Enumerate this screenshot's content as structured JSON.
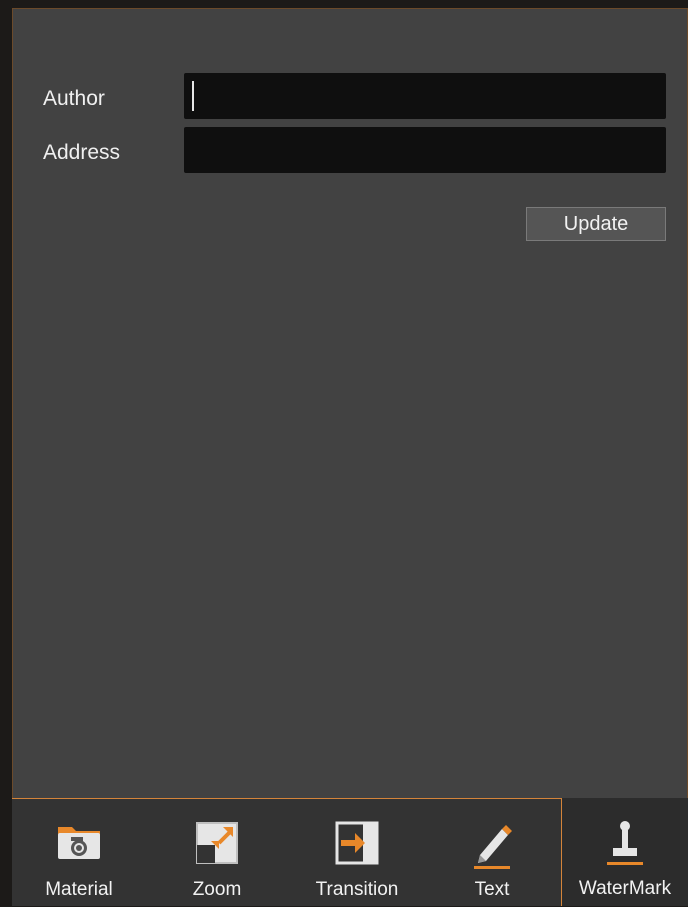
{
  "form": {
    "author_label": "Author",
    "author_value": "",
    "address_label": "Address",
    "address_value": "",
    "update_label": "Update"
  },
  "tabs": [
    {
      "label": "Material",
      "icon": "camera-folder-icon"
    },
    {
      "label": "Zoom",
      "icon": "zoom-expand-icon"
    },
    {
      "label": "Transition",
      "icon": "transition-arrow-icon"
    },
    {
      "label": "Text",
      "icon": "pencil-icon"
    },
    {
      "label": "WaterMark",
      "icon": "stamp-icon",
      "active": true
    }
  ],
  "colors": {
    "accent": "#d4843a",
    "panel": "#424242",
    "field": "#0f0f0f",
    "tabbar": "#333333"
  }
}
